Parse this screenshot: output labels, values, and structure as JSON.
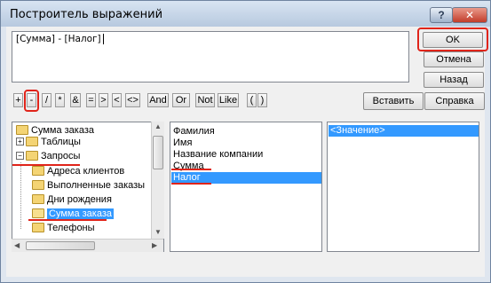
{
  "window": {
    "title": "Построитель выражений"
  },
  "titlebar": {
    "help_label": "?",
    "close_label": "✕"
  },
  "expression": {
    "text": "[Сумма] - [Налог]"
  },
  "buttons": {
    "ok": "OK",
    "cancel": "Отмена",
    "back": "Назад",
    "paste": "Вставить",
    "help": "Справка"
  },
  "operators": [
    "+",
    "-",
    "/",
    "*",
    "&",
    "=",
    ">",
    "<",
    "<>",
    "And",
    "Or",
    "Not",
    "Like",
    "(",
    ")"
  ],
  "tree": {
    "items": [
      {
        "label": "Сумма заказа"
      },
      {
        "label": "Таблицы"
      },
      {
        "label": "Запросы"
      },
      {
        "label": "Адреса клиентов"
      },
      {
        "label": "Выполненные заказы"
      },
      {
        "label": "Дни рождения"
      },
      {
        "label": "Сумма заказа"
      },
      {
        "label": "Телефоны"
      }
    ],
    "selected": "Сумма заказа"
  },
  "fields": {
    "items": [
      "Фамилия",
      "Имя",
      "Название компании",
      "Сумма",
      "Налог"
    ],
    "selected": "Налог"
  },
  "values": {
    "items": [
      "<Значение>"
    ],
    "selected": "<Значение>"
  },
  "colors": {
    "accent": "#3399ff",
    "annotation": "#e0241a"
  }
}
